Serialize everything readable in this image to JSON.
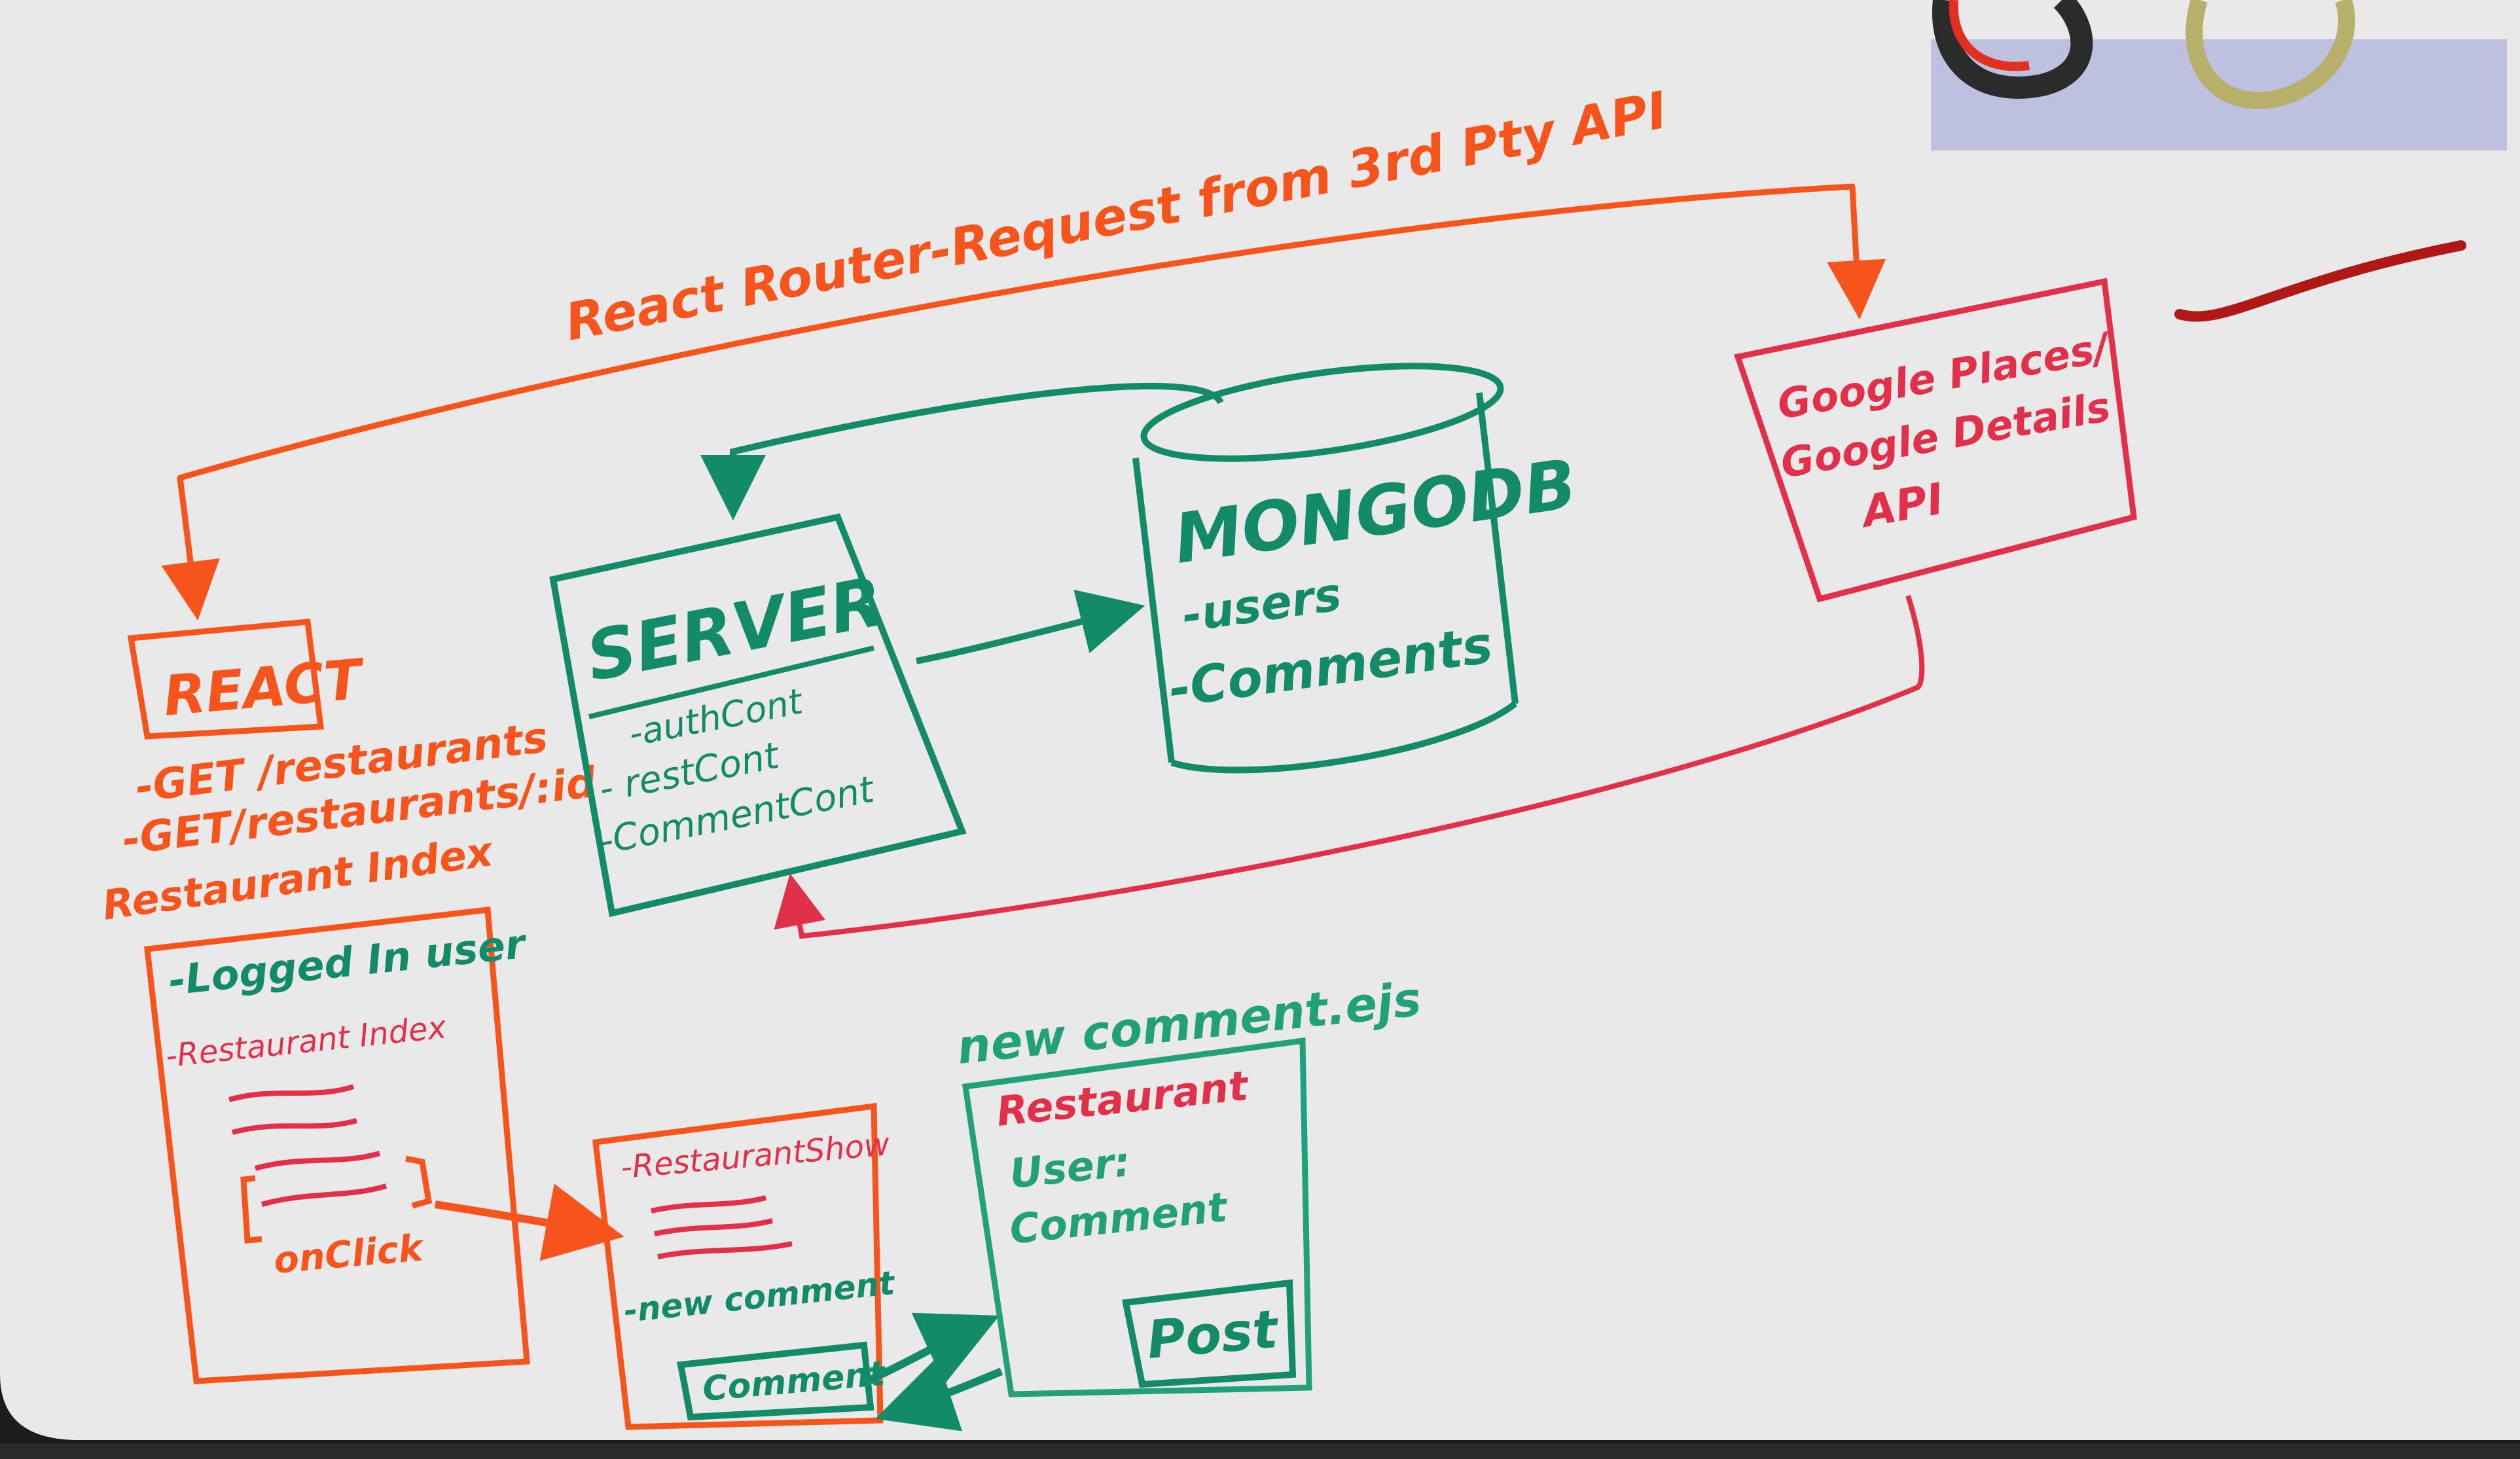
{
  "colors": {
    "orange": "#f5541c",
    "green": "#138a68",
    "teal": "#22a07a",
    "crimson": "#e0304a",
    "board": "#e9e9ea"
  },
  "top_arrow": {
    "label": "React Router-Request from 3rd Pty API"
  },
  "react": {
    "label": "REACT",
    "routes": [
      "-GET /restaurants",
      "-GET/restaurants/:id"
    ]
  },
  "restaurant_index": {
    "title": "Restaurant Index",
    "logged_in": "-Logged In user",
    "index_label": "-Restaurant Index",
    "onclick": "onClick"
  },
  "server": {
    "title": "SERVER",
    "items": [
      "-authCont",
      "- restCont",
      "-CommentCont"
    ]
  },
  "mongodb": {
    "title": "MONGODB",
    "items": [
      "-users",
      "-Comments"
    ]
  },
  "google_api": {
    "lines": [
      "Google Places/",
      "Google Details",
      "API"
    ]
  },
  "restaurant_show": {
    "title": "-RestaurantShow",
    "new_comment": "-new comment",
    "comment_button": "Comment"
  },
  "new_comment": {
    "title": "new comment.ejs",
    "fields": [
      "Restaurant",
      "User:",
      "Comment"
    ],
    "post_button": "Post"
  }
}
